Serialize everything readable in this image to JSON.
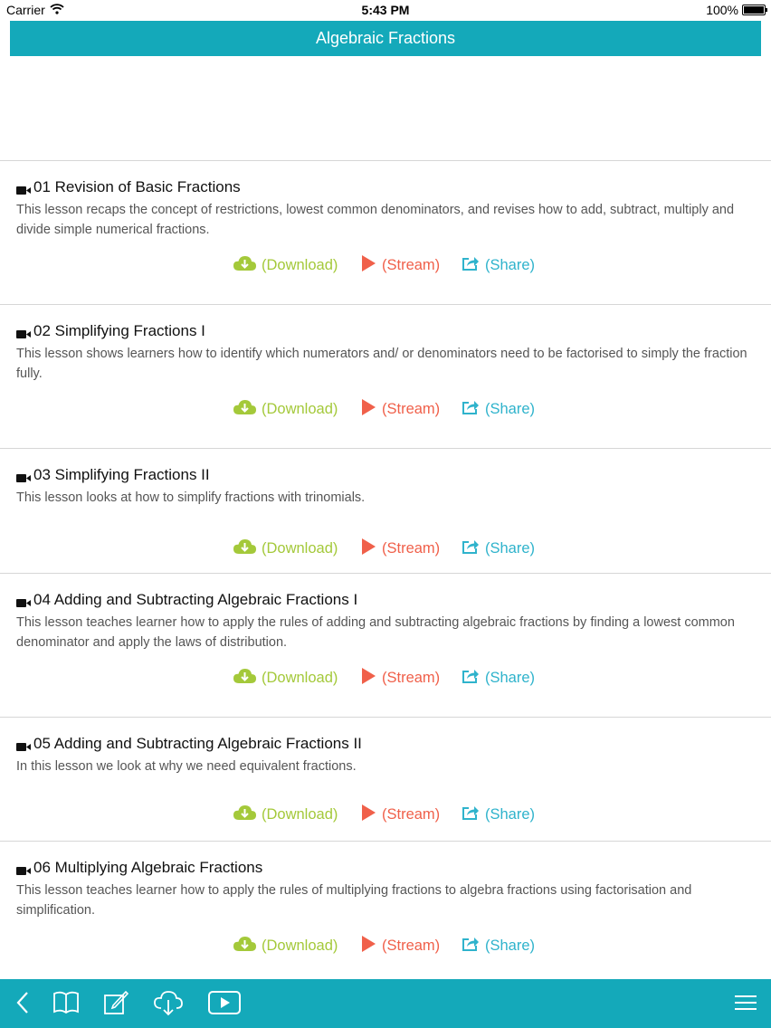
{
  "status_bar": {
    "carrier": "Carrier",
    "time": "5:43 PM",
    "battery": "100%"
  },
  "header": {
    "title": "Algebraic Fractions"
  },
  "actions": {
    "download": "(Download)",
    "stream": "(Stream)",
    "share": "(Share)"
  },
  "lessons": [
    {
      "title": "01 Revision of Basic Fractions",
      "description": "This lesson recaps the concept of restrictions, lowest common denominators, and revises how to add, subtract, multiply and divide simple numerical fractions."
    },
    {
      "title": "02 Simplifying Fractions I",
      "description": "This lesson shows learners how to identify which numerators and/ or denominators need to be factorised to simply the fraction fully."
    },
    {
      "title": "03 Simplifying Fractions II",
      "description": "This lesson looks at how to simplify fractions with trinomials."
    },
    {
      "title": "04 Adding and Subtracting Algebraic Fractions I",
      "description": "This lesson teaches learner how to apply the rules of adding and subtracting algebraic fractions by finding a lowest common denominator and apply the laws of distribution."
    },
    {
      "title": "05 Adding and Subtracting Algebraic Fractions II",
      "description": "In this lesson we look at why we need equivalent fractions."
    },
    {
      "title": "06 Multiplying Algebraic Fractions",
      "description": "This lesson teaches learner how to apply the rules of multiplying fractions to algebra fractions using factorisation and simplification."
    }
  ],
  "toolbar_icons": [
    "back-icon",
    "book-icon",
    "edit-icon",
    "cloud-download-icon",
    "play-icon",
    "menu-icon"
  ],
  "colors": {
    "accent": "#14a9ba",
    "download": "#a4c93a",
    "stream": "#f0604a",
    "share": "#2fb3cc"
  }
}
